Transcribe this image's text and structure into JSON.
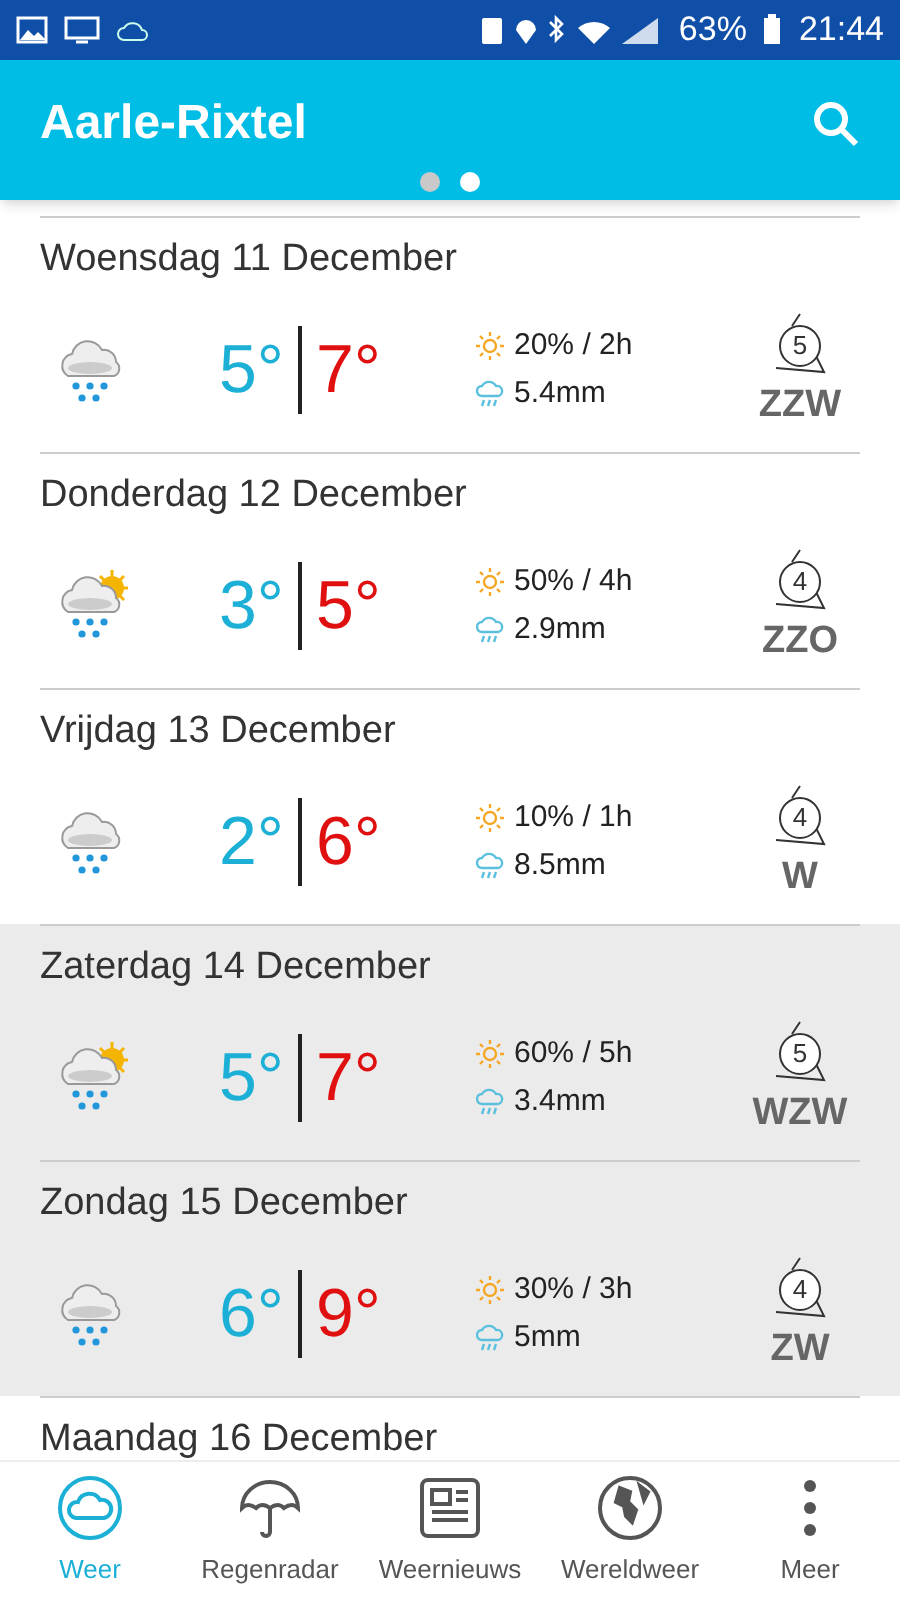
{
  "status_bar": {
    "battery": "63%",
    "time": "21:44"
  },
  "app_bar": {
    "title": "Aarle-Rixtel",
    "pages": [
      {
        "selected": false
      },
      {
        "selected": true
      }
    ]
  },
  "days": [
    {
      "date": "Woensdag 11 December",
      "weekend": false,
      "kind": "rain",
      "low": "5°",
      "high": "7°",
      "sun": "20% / 2h",
      "rain": "5.4mm",
      "wind_force": "5",
      "wind_dir": "ZZW"
    },
    {
      "date": "Donderdag 12 December",
      "weekend": false,
      "kind": "sun-rain",
      "low": "3°",
      "high": "5°",
      "sun": "50% / 4h",
      "rain": "2.9mm",
      "wind_force": "4",
      "wind_dir": "ZZO"
    },
    {
      "date": "Vrijdag 13 December",
      "weekend": false,
      "kind": "rain",
      "low": "2°",
      "high": "6°",
      "sun": "10% / 1h",
      "rain": "8.5mm",
      "wind_force": "4",
      "wind_dir": "W"
    },
    {
      "date": "Zaterdag 14 December",
      "weekend": true,
      "kind": "sun-rain",
      "low": "5°",
      "high": "7°",
      "sun": "60% / 5h",
      "rain": "3.4mm",
      "wind_force": "5",
      "wind_dir": "WZW"
    },
    {
      "date": "Zondag 15 December",
      "weekend": true,
      "kind": "rain",
      "low": "6°",
      "high": "9°",
      "sun": "30% / 3h",
      "rain": "5mm",
      "wind_force": "4",
      "wind_dir": "ZW"
    },
    {
      "date": "Maandag 16 December",
      "weekend": false
    }
  ],
  "nav": [
    {
      "label": "Weer",
      "kind": "weather",
      "selected": true
    },
    {
      "label": "Regenradar",
      "kind": "umbrella",
      "selected": false
    },
    {
      "label": "Weernieuws",
      "kind": "news",
      "selected": false
    },
    {
      "label": "Wereldweer",
      "kind": "globe",
      "selected": false
    },
    {
      "label": "Meer",
      "kind": "more",
      "selected": false
    }
  ]
}
